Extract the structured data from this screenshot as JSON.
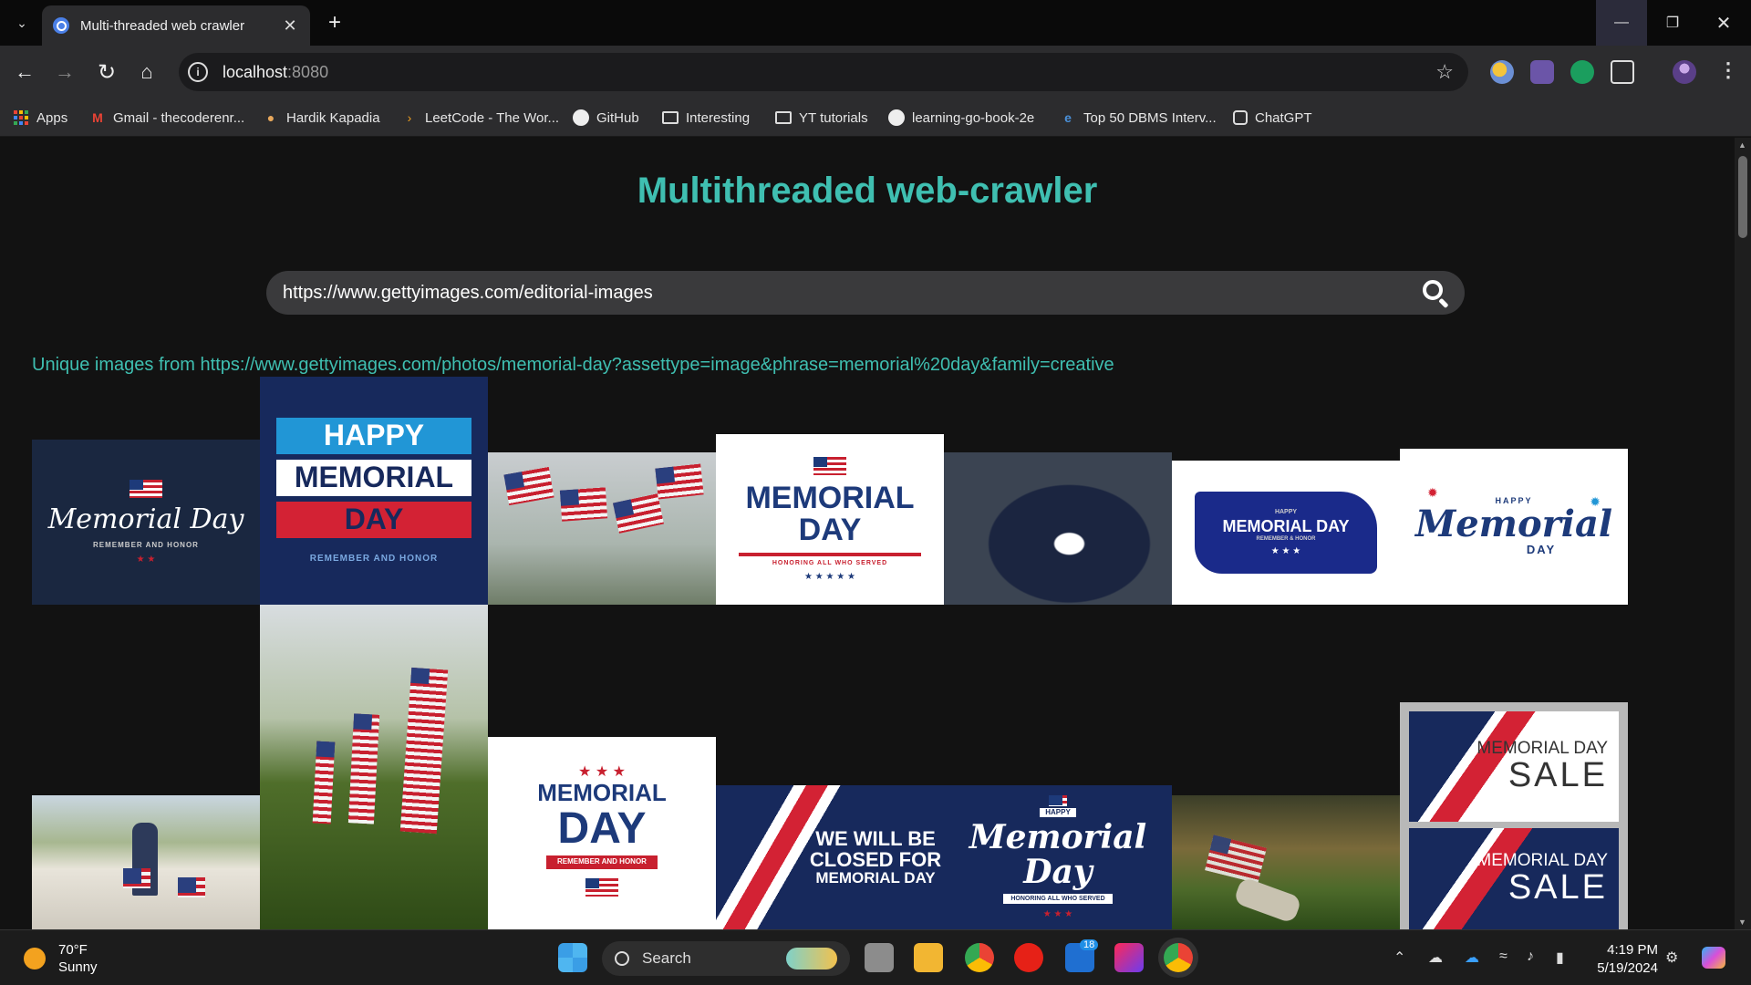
{
  "browser": {
    "tab_title": "Multi-threaded web crawler",
    "url_host": "localhost",
    "url_port": ":8080",
    "bookmarks": [
      {
        "label": "Apps",
        "icon": "apps-grid-icon"
      },
      {
        "label": "Gmail - thecoderenr...",
        "icon": "gmail-icon"
      },
      {
        "label": "Hardik Kapadia",
        "icon": "person-icon"
      },
      {
        "label": "LeetCode - The Wor...",
        "icon": "leetcode-icon"
      },
      {
        "label": "GitHub",
        "icon": "github-icon"
      },
      {
        "label": "Interesting",
        "icon": "folder-icon"
      },
      {
        "label": "YT tutorials",
        "icon": "folder-icon"
      },
      {
        "label": "learning-go-book-2e",
        "icon": "github-icon"
      },
      {
        "label": "Top 50 DBMS Interv...",
        "icon": "edureka-icon"
      },
      {
        "label": "ChatGPT",
        "icon": "chatgpt-icon"
      }
    ]
  },
  "page": {
    "heading": "Multithreaded web-crawler",
    "search_value": "https://www.gettyimages.com/editorial-images",
    "results_label": "Unique images from https://www.gettyimages.com/photos/memorial-day?assettype=image&phrase=memorial%20day&family=creative",
    "images": [
      {
        "lines": [
          "Memorial Day",
          "REMEMBER AND HONOR"
        ]
      },
      {
        "lines": [
          "HAPPY",
          "MEMORIAL",
          "DAY",
          "REMEMBER AND HONOR"
        ]
      },
      {
        "lines": []
      },
      {
        "lines": [
          "MEMORIAL DAY",
          "HONORING ALL WHO SERVED"
        ]
      },
      {
        "lines": []
      },
      {
        "lines": [
          "HAPPY",
          "MEMORIAL DAY",
          "REMEMBER & HONOR"
        ]
      },
      {
        "lines": [
          "HAPPY",
          "Memorial",
          "DAY"
        ]
      },
      {
        "lines": []
      },
      {
        "lines": []
      },
      {
        "lines": [
          "MEMORIAL",
          "DAY",
          "REMEMBER AND HONOR"
        ]
      },
      {
        "lines": [
          "WE WILL BE",
          "CLOSED FOR",
          "MEMORIAL DAY"
        ]
      },
      {
        "lines": [
          "HAPPY",
          "Memorial Day",
          "HONORING ALL WHO SERVED"
        ]
      },
      {
        "lines": []
      },
      {
        "lines": [
          "MEMORIAL DAY",
          "SALE",
          "MEMORIAL DAY",
          "SALE"
        ]
      }
    ]
  },
  "taskbar": {
    "temperature": "70°F",
    "condition": "Sunny",
    "search_label": "Search",
    "mail_badge": "18",
    "time": "4:19 PM",
    "date": "5/19/2024"
  },
  "colors": {
    "accent": "#3fbfb1",
    "background": "#121212",
    "navy": "#17295c",
    "flag_red": "#c8202f"
  }
}
